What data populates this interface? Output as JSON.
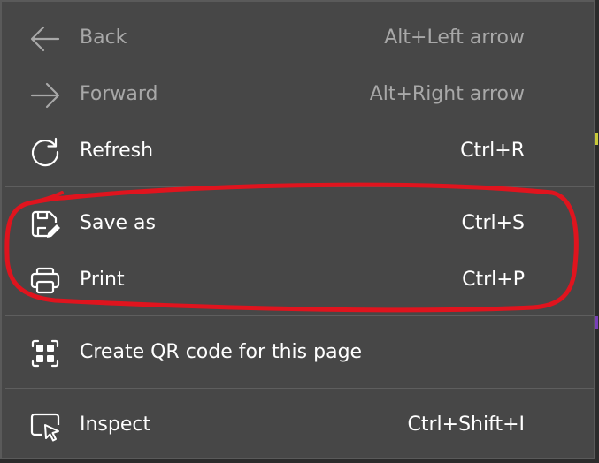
{
  "menu": {
    "items": [
      {
        "label": "Back",
        "shortcut": "Alt+Left arrow",
        "icon": "arrow-left-icon"
      },
      {
        "label": "Forward",
        "shortcut": "Alt+Right arrow",
        "icon": "arrow-right-icon"
      },
      {
        "label": "Refresh",
        "shortcut": "Ctrl+R",
        "icon": "refresh-icon"
      },
      {
        "label": "Save as",
        "shortcut": "Ctrl+S",
        "icon": "save-as-icon"
      },
      {
        "label": "Print",
        "shortcut": "Ctrl+P",
        "icon": "printer-icon"
      },
      {
        "label": "Create QR code for this page",
        "shortcut": "",
        "icon": "qr-code-icon"
      },
      {
        "label": "Inspect",
        "shortcut": "Ctrl+Shift+I",
        "icon": "inspect-icon"
      }
    ]
  },
  "colors": {
    "menu_background": "#474747",
    "text": "#ffffff",
    "disabled_text": "#a8a8a8",
    "annotation": "#e0141e"
  }
}
